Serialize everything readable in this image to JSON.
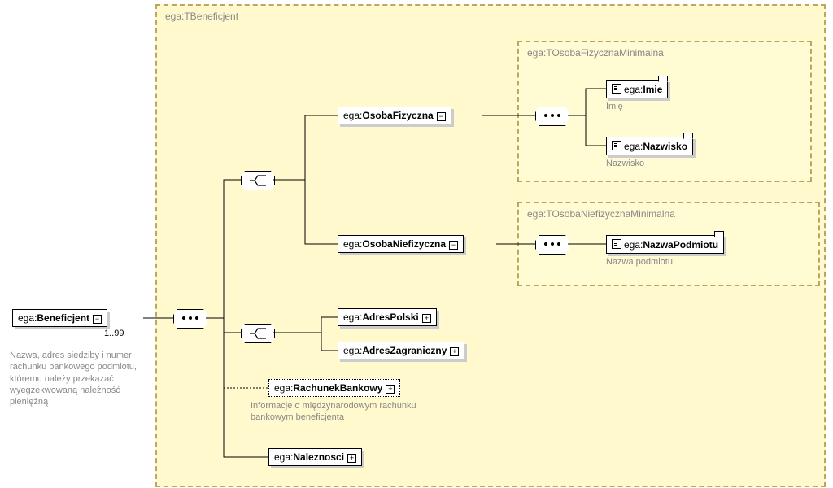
{
  "root": {
    "prefix": "ega:",
    "name": "Beneficjent",
    "occurrence": "1..99",
    "doc": "Nazwa, adres siedziby i numer rachunku bankowego podmiotu, któremu należy przekazać wyegzekwowaną należność pieniężną"
  },
  "mainType": {
    "label": "ega:TBeneficjent"
  },
  "personChoice": {
    "fizyczna": {
      "prefix": "ega:",
      "name": "OsobaFizyczna"
    },
    "niefizyczna": {
      "prefix": "ega:",
      "name": "OsobaNiefizyczna"
    }
  },
  "addressChoice": {
    "polski": {
      "prefix": "ega:",
      "name": "AdresPolski"
    },
    "zagraniczny": {
      "prefix": "ega:",
      "name": "AdresZagraniczny"
    }
  },
  "rachunek": {
    "prefix": "ega:",
    "name": "RachunekBankowy",
    "doc": "Informacje o międzynarodowym rachunku bankowym beneficjenta"
  },
  "naleznosci": {
    "prefix": "ega:",
    "name": "Naleznosci"
  },
  "fizType": {
    "label": "ega:TOsobaFizycznaMinimalna",
    "imie": {
      "prefix": "ega:",
      "name": "Imie",
      "doc": "Imię"
    },
    "nazwisko": {
      "prefix": "ega:",
      "name": "Nazwisko",
      "doc": "Nazwisko"
    }
  },
  "niefizType": {
    "label": "ega:TOsobaNiefizycznaMinimalna",
    "nazwa": {
      "prefix": "ega:",
      "name": "NazwaPodmiotu",
      "doc": "Nazwa podmiotu"
    }
  }
}
